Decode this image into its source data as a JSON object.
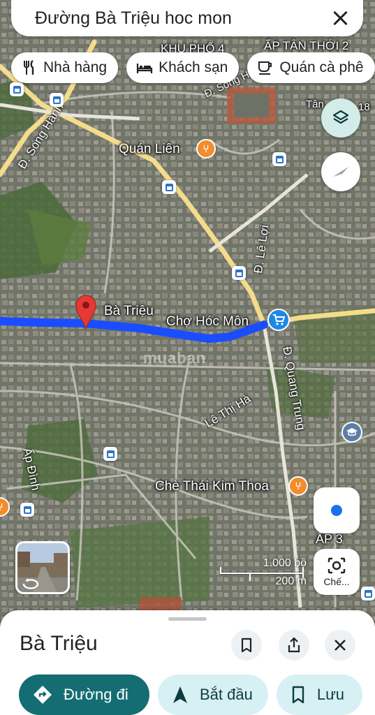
{
  "search": {
    "query": "Đường Bà Triệu hoc mon"
  },
  "chips": [
    {
      "label": "Nhà hàng",
      "icon": "fork-knife-icon"
    },
    {
      "label": "Khách sạn",
      "icon": "bed-icon"
    },
    {
      "label": "Quán cà phê",
      "icon": "coffee-cup-icon"
    }
  ],
  "map": {
    "area_labels": [
      "KHU PHỐ 4",
      "ẤP TÂN THỚI 2",
      "Tân",
      "18",
      "ẤP 3"
    ],
    "road_labels": [
      "Đ. Song Hành",
      "Đ. Lê Lợi",
      "Đ. Quang Trung",
      "Lê Thị Hà",
      "Ấp Đình",
      "Đ. Song Hà"
    ],
    "places": {
      "pin": "Bà Triệu",
      "market": "Chợ Hóc Môn",
      "quan_lien": "Quán Liên",
      "che": "Chè Thái Kim Thoa"
    },
    "route_color": "#1a4dff",
    "watermark": "muaban"
  },
  "scale": {
    "imperial": "1.000 bộ",
    "metric": "200 m"
  },
  "lens_label": "Chế...",
  "sheet": {
    "title": "Bà Triệu",
    "actions": [
      {
        "label": "Đường đi",
        "icon": "directions-icon"
      },
      {
        "label": "Bắt đầu",
        "icon": "navigation-arrow-icon"
      },
      {
        "label": "Lưu",
        "icon": "bookmark-icon"
      }
    ]
  }
}
